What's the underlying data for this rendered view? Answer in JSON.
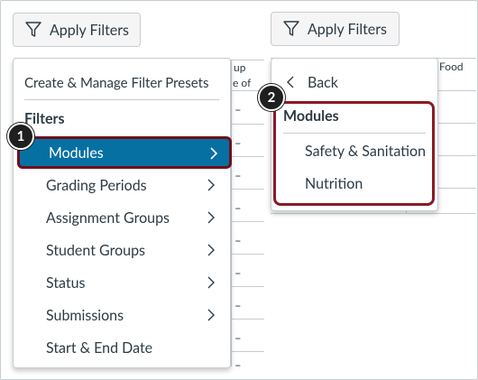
{
  "left_panel": {
    "apply_filters_label": "Apply Filters",
    "header_fragment_1": "up",
    "header_fragment_2": "e of",
    "cell_dash": "–",
    "menu": {
      "presets_label": "Create & Manage Filter Presets",
      "filters_heading": "Filters",
      "items": [
        {
          "label": "Modules",
          "has_submenu": true,
          "selected": true
        },
        {
          "label": "Grading Periods",
          "has_submenu": true
        },
        {
          "label": "Assignment Groups",
          "has_submenu": true
        },
        {
          "label": "Student Groups",
          "has_submenu": true
        },
        {
          "label": "Status",
          "has_submenu": true
        },
        {
          "label": "Submissions",
          "has_submenu": true
        },
        {
          "label": "Start & End Date",
          "has_submenu": false
        }
      ]
    },
    "callout_number": "1"
  },
  "right_panel": {
    "apply_filters_label": "Apply Filters",
    "header_fragment": "Food",
    "menu": {
      "back_label": "Back",
      "modules_heading": "Modules",
      "items": [
        {
          "label": "Safety & Sanitation"
        },
        {
          "label": "Nutrition"
        }
      ]
    },
    "callout_number": "2"
  },
  "colors": {
    "selected_bg": "#0770a3",
    "callout_border": "#8b1a28",
    "badge_bg": "#1f1f1f"
  }
}
